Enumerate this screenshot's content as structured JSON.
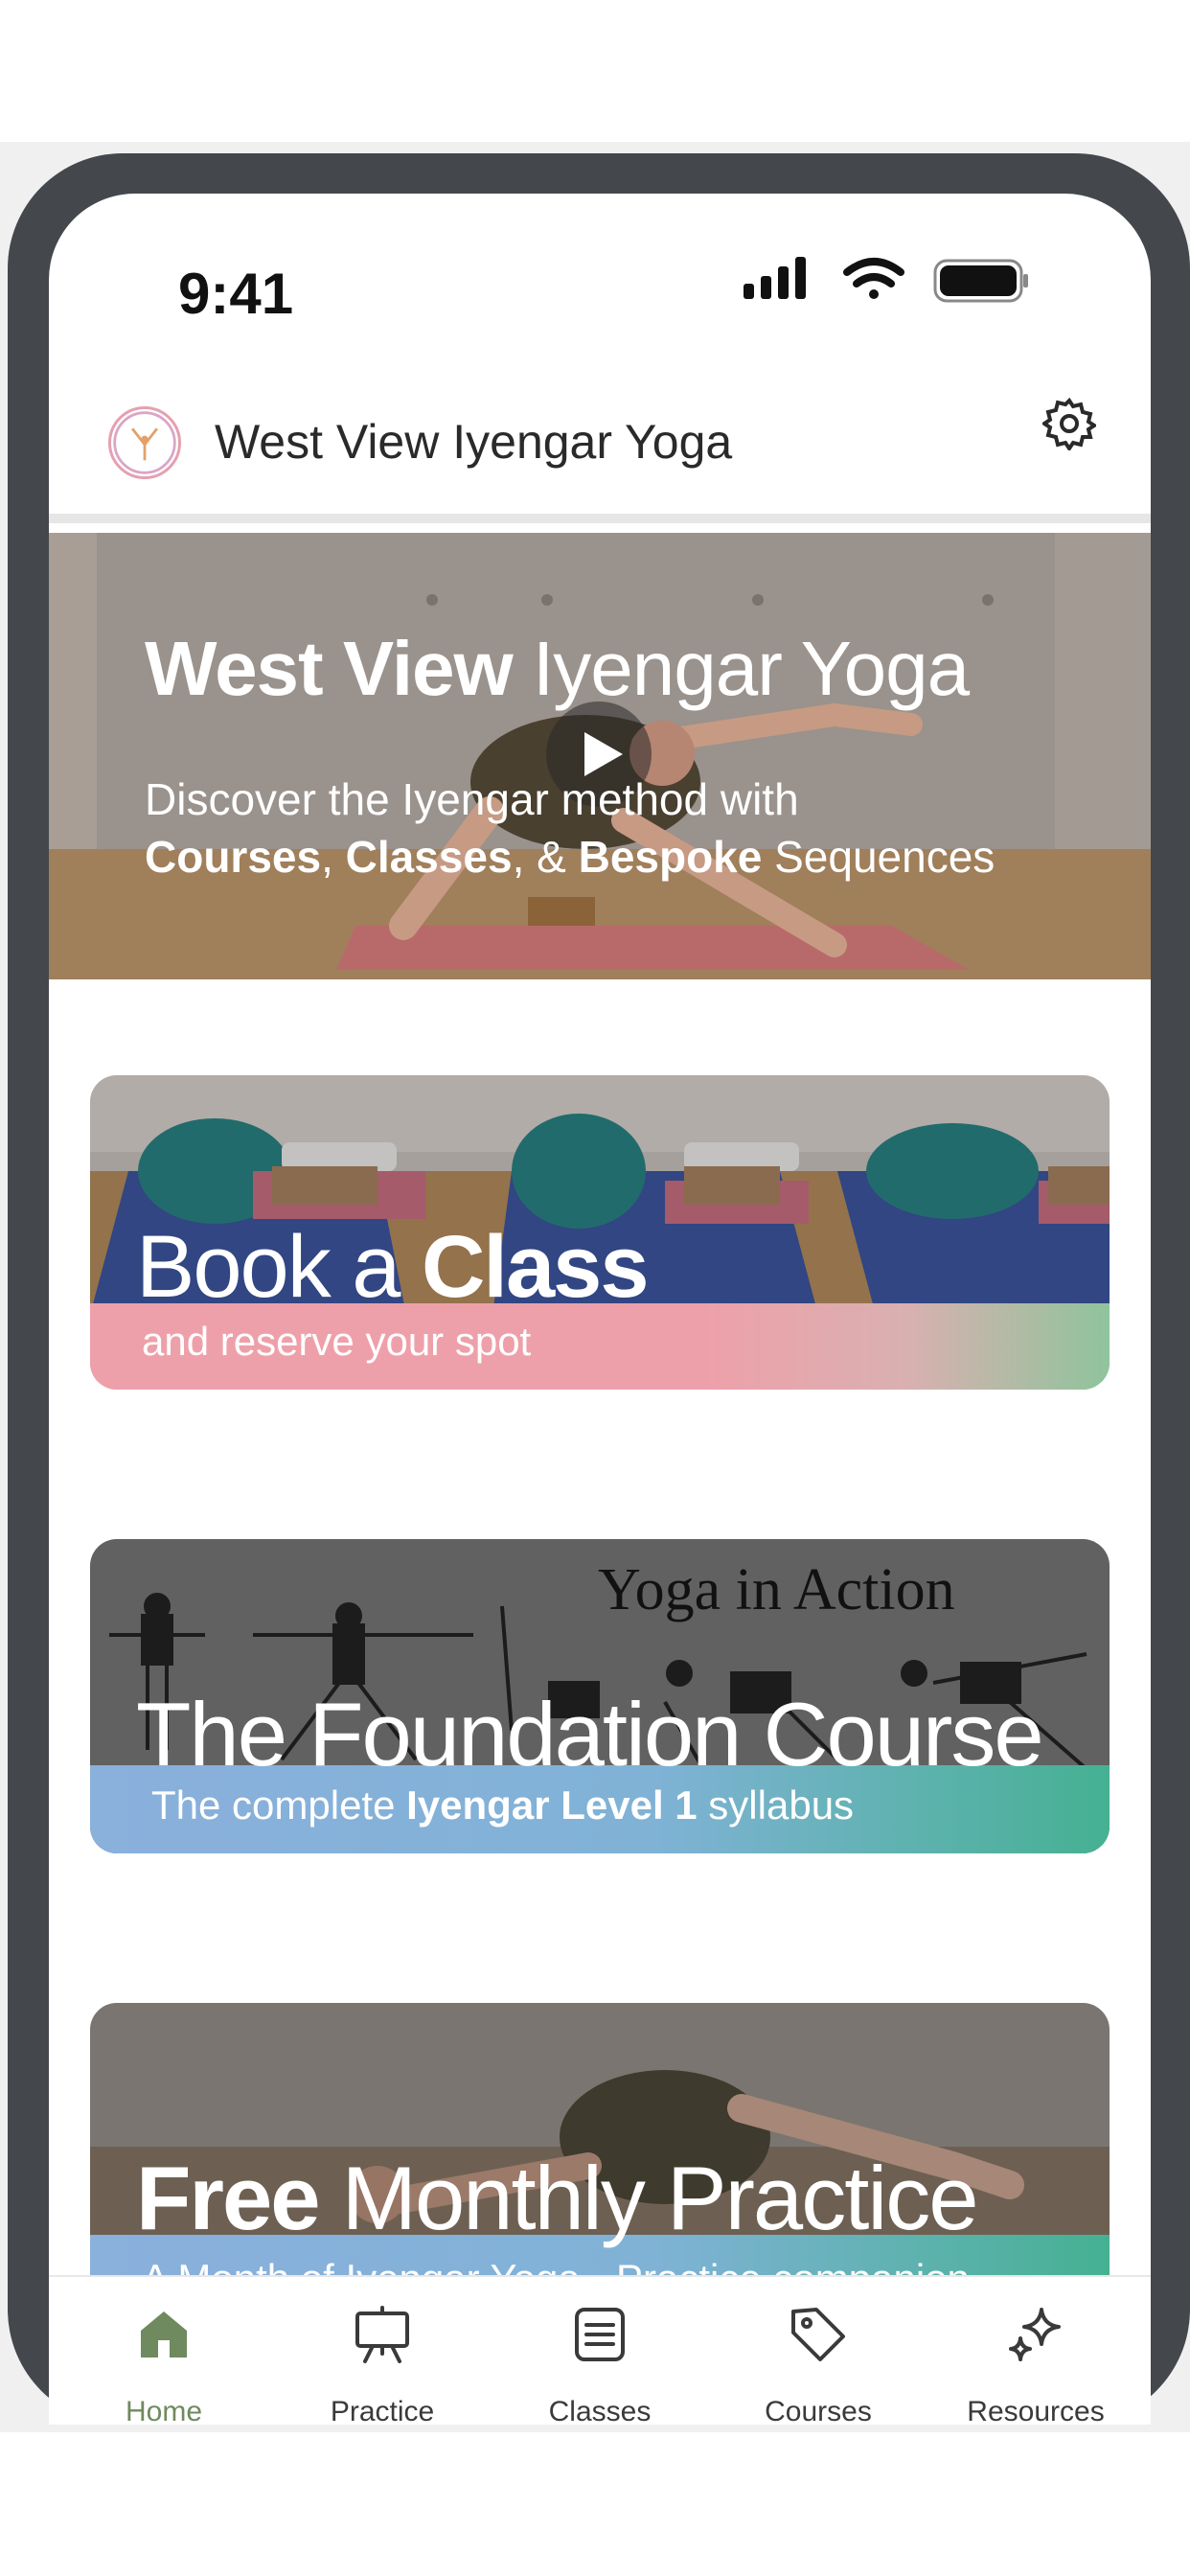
{
  "status_bar": {
    "time": "9:41"
  },
  "header": {
    "title": "West View Iyengar Yoga"
  },
  "hero": {
    "title_bold": "West View",
    "title_rest": "Iyengar Yoga",
    "sub_line1": "Discover the Iyengar method with",
    "sub_bold1": "Courses",
    "sub_sep1": ", ",
    "sub_bold2": "Classes",
    "sub_sep2": ", & ",
    "sub_bold3": "Bespoke",
    "sub_rest": " Sequences"
  },
  "cards": {
    "book": {
      "title_light": "Book a ",
      "title_bold": "Class",
      "subtitle": "and reserve your spot"
    },
    "foundation": {
      "overlay_text": "Yoga in Action",
      "title": "The Foundation Course",
      "sub_pre": "The complete ",
      "sub_bold": "Iyengar Level 1",
      "sub_post": " syllabus"
    },
    "monthly": {
      "title_bold": "Free",
      "title_light": " Monthly Practice",
      "subtitle": "A Month of Iyengar Yoga - Practice companion"
    }
  },
  "tabbar": {
    "items": [
      {
        "label": "Home",
        "icon": "home-icon",
        "active": true
      },
      {
        "label": "Practice",
        "icon": "easel-icon",
        "active": false
      },
      {
        "label": "Classes",
        "icon": "list-icon",
        "active": false
      },
      {
        "label": "Courses",
        "icon": "tag-icon",
        "active": false
      },
      {
        "label": "Resources",
        "icon": "sparkle-icon",
        "active": false
      }
    ]
  },
  "colors": {
    "frame": "#44484d",
    "active_tab": "#6f8a5e",
    "book_strip_start": "#eea0aa",
    "book_strip_end": "#8fc49c",
    "foundation_strip_start": "#8ab0dc",
    "foundation_strip_end": "#45b192"
  }
}
